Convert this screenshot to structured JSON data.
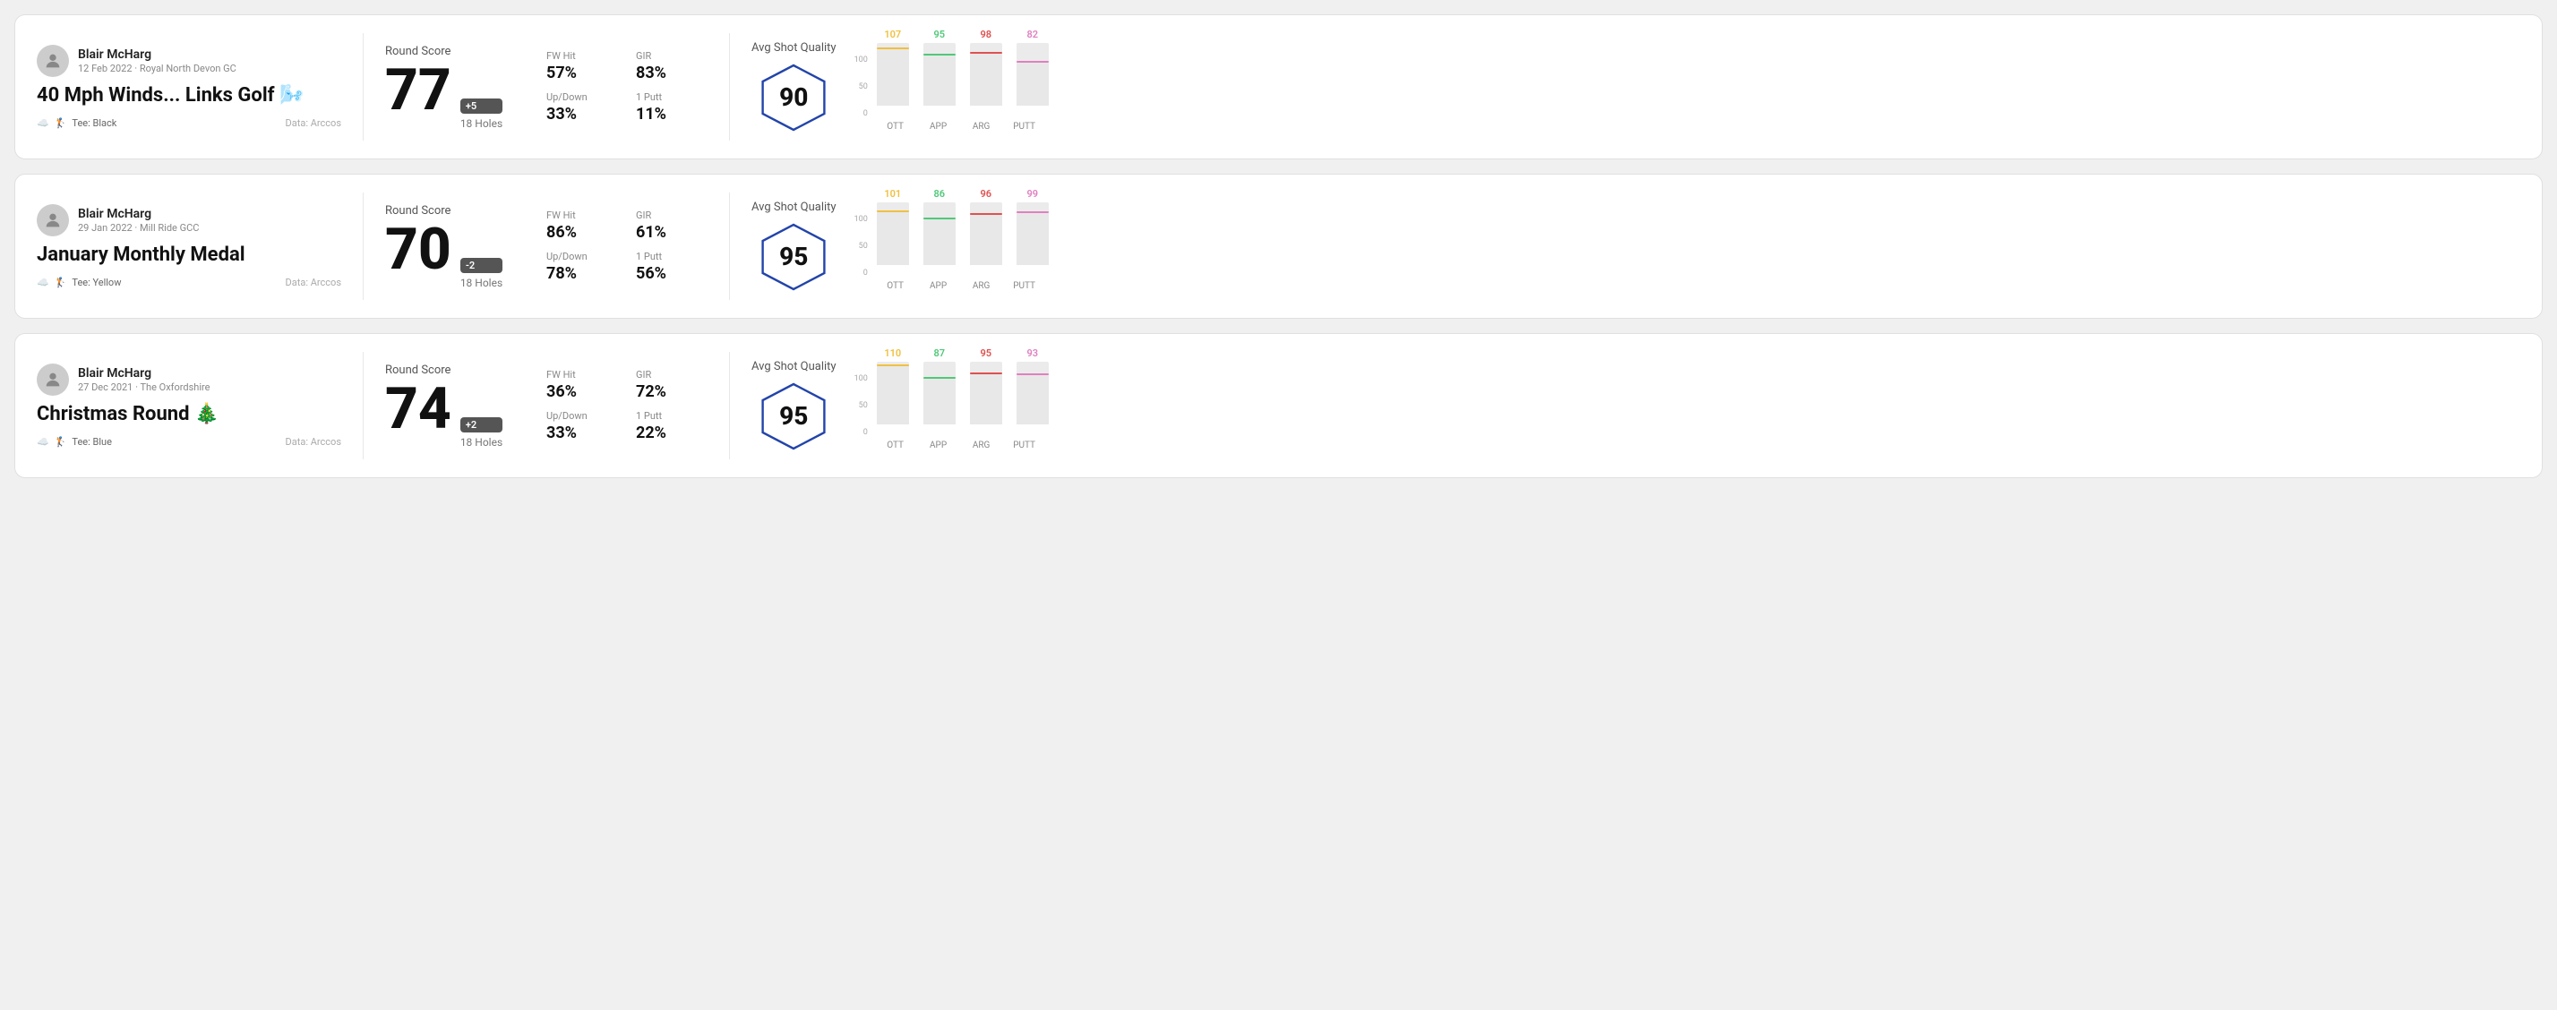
{
  "rounds": [
    {
      "id": "round1",
      "user_name": "Blair McHarg",
      "date_course": "12 Feb 2022 · Royal North Devon GC",
      "title": "40 Mph Winds... Links Golf 🌬️",
      "tee": "Tee: Black",
      "data_source": "Data: Arccos",
      "score": "77",
      "score_diff": "+5",
      "holes": "18 Holes",
      "fw_hit": "57%",
      "gir": "83%",
      "up_down": "33%",
      "one_putt": "11%",
      "avg_shot_quality": "90",
      "bars": [
        {
          "label": "OTT",
          "value": 107,
          "color": "#f0c040"
        },
        {
          "label": "APP",
          "value": 95,
          "color": "#50c878"
        },
        {
          "label": "ARG",
          "value": 98,
          "color": "#e05050"
        },
        {
          "label": "PUTT",
          "value": 82,
          "color": "#e080c0"
        }
      ]
    },
    {
      "id": "round2",
      "user_name": "Blair McHarg",
      "date_course": "29 Jan 2022 · Mill Ride GCC",
      "title": "January Monthly Medal",
      "tee": "Tee: Yellow",
      "data_source": "Data: Arccos",
      "score": "70",
      "score_diff": "-2",
      "holes": "18 Holes",
      "fw_hit": "86%",
      "gir": "61%",
      "up_down": "78%",
      "one_putt": "56%",
      "avg_shot_quality": "95",
      "bars": [
        {
          "label": "OTT",
          "value": 101,
          "color": "#f0c040"
        },
        {
          "label": "APP",
          "value": 86,
          "color": "#50c878"
        },
        {
          "label": "ARG",
          "value": 96,
          "color": "#e05050"
        },
        {
          "label": "PUTT",
          "value": 99,
          "color": "#e080c0"
        }
      ]
    },
    {
      "id": "round3",
      "user_name": "Blair McHarg",
      "date_course": "27 Dec 2021 · The Oxfordshire",
      "title": "Christmas Round 🎄",
      "tee": "Tee: Blue",
      "data_source": "Data: Arccos",
      "score": "74",
      "score_diff": "+2",
      "holes": "18 Holes",
      "fw_hit": "36%",
      "gir": "72%",
      "up_down": "33%",
      "one_putt": "22%",
      "avg_shot_quality": "95",
      "bars": [
        {
          "label": "OTT",
          "value": 110,
          "color": "#f0c040"
        },
        {
          "label": "APP",
          "value": 87,
          "color": "#50c878"
        },
        {
          "label": "ARG",
          "value": 95,
          "color": "#e05050"
        },
        {
          "label": "PUTT",
          "value": 93,
          "color": "#e080c0"
        }
      ]
    }
  ],
  "labels": {
    "round_score": "Round Score",
    "fw_hit": "FW Hit",
    "gir": "GIR",
    "up_down": "Up/Down",
    "one_putt": "1 Putt",
    "avg_shot_quality": "Avg Shot Quality",
    "y100": "100",
    "y50": "50",
    "y0": "0"
  }
}
